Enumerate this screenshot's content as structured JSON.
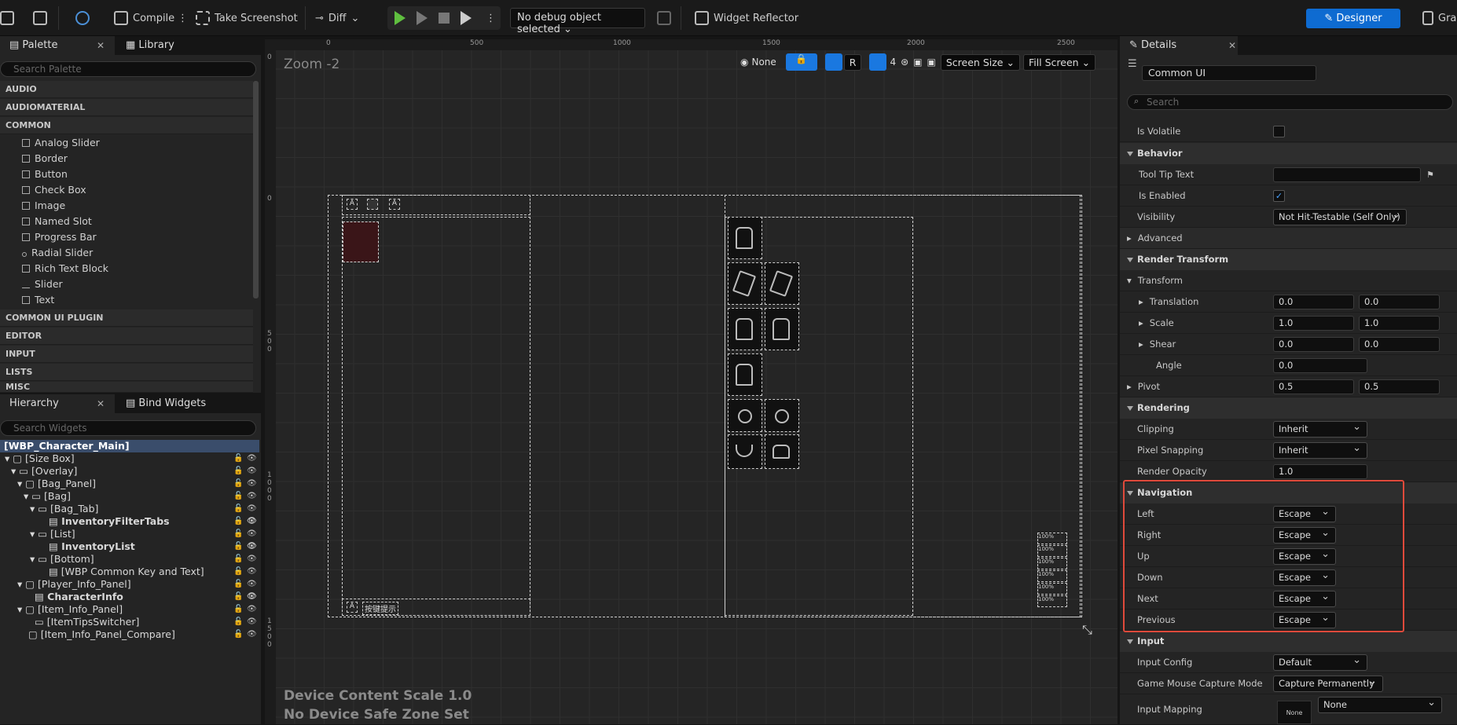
{
  "toolbar": {
    "compile": "Compile",
    "take_screenshot": "Take Screenshot",
    "diff": "Diff",
    "debug_object": "No debug object selected",
    "widget_reflector": "Widget Reflector",
    "designer": "Designer",
    "graph_partial": "Gra"
  },
  "palette": {
    "tab_palette": "Palette",
    "tab_library": "Library",
    "search_placeholder": "Search Palette",
    "categories": [
      "AUDIO",
      "AUDIOMATERIAL",
      "COMMON",
      "COMMON UI PLUGIN",
      "EDITOR",
      "INPUT",
      "LISTS",
      "MISC"
    ],
    "common_items": [
      "Analog Slider",
      "Border",
      "Button",
      "Check Box",
      "Image",
      "Named Slot",
      "Progress Bar",
      "Radial Slider",
      "Rich Text Block",
      "Slider",
      "Text"
    ]
  },
  "hierarchy": {
    "tab_hierarchy": "Hierarchy",
    "tab_bind": "Bind Widgets",
    "search_placeholder": "Search Widgets",
    "root": "[WBP_Character_Main]",
    "rows": [
      "[Size Box]",
      "[Overlay]",
      "[Bag_Panel]",
      "[Bag]",
      "[Bag_Tab]",
      "InventoryFilterTabs",
      "[List]",
      "InventoryList",
      "[Bottom]",
      "[WBP Common Key and Text]",
      "[Player_Info_Panel]",
      "CharacterInfo",
      "[Item_Info_Panel]",
      "[ItemTipsSwitcher]",
      "[Item_Info_Panel_Compare]"
    ]
  },
  "canvas": {
    "zoom": "Zoom -2",
    "ruler_top": [
      "0",
      "500",
      "1000",
      "1500",
      "2000",
      "2500"
    ],
    "ruler_left": [
      "0",
      "500",
      "1000",
      "1500"
    ],
    "none_label": "None",
    "r_label": "R",
    "grid_value": "4",
    "screen_size": "Screen Size",
    "fill_screen": "Fill Screen",
    "device_scale": "Device Content Scale 1.0",
    "safe_zone": "No Device Safe Zone Set",
    "bottom_key_text": "按键提示",
    "percent_label": "100%",
    "a_label": "A"
  },
  "details": {
    "tab": "Details",
    "name_value": "Common UI",
    "search_placeholder": "Search",
    "is_volatile": "Is Volatile",
    "behavior": "Behavior",
    "tool_tip_text": "Tool Tip Text",
    "is_enabled": "Is Enabled",
    "visibility": "Visibility",
    "visibility_value": "Not Hit-Testable (Self Only)",
    "advanced": "Advanced",
    "render_transform": "Render Transform",
    "transform": "Transform",
    "translation": "Translation",
    "translation_x": "0.0",
    "translation_y": "0.0",
    "scale": "Scale",
    "scale_x": "1.0",
    "scale_y": "1.0",
    "shear": "Shear",
    "shear_x": "0.0",
    "shear_y": "0.0",
    "angle": "Angle",
    "angle_value": "0.0",
    "pivot": "Pivot",
    "pivot_x": "0.5",
    "pivot_y": "0.5",
    "rendering": "Rendering",
    "clipping": "Clipping",
    "clipping_value": "Inherit",
    "pixel_snapping": "Pixel Snapping",
    "pixel_snapping_value": "Inherit",
    "render_opacity": "Render Opacity",
    "render_opacity_value": "1.0",
    "navigation": "Navigation",
    "nav_rows": [
      {
        "label": "Left",
        "value": "Escape"
      },
      {
        "label": "Right",
        "value": "Escape"
      },
      {
        "label": "Up",
        "value": "Escape"
      },
      {
        "label": "Down",
        "value": "Escape"
      },
      {
        "label": "Next",
        "value": "Escape"
      },
      {
        "label": "Previous",
        "value": "Escape"
      }
    ],
    "input": "Input",
    "input_config": "Input Config",
    "input_config_value": "Default",
    "game_mouse": "Game Mouse Capture Mode",
    "game_mouse_value": "Capture Permanently",
    "input_mapping": "Input Mapping",
    "input_mapping_value": "None",
    "input_mapping_thumb": "None"
  },
  "colors": {
    "accent": "#0e6bd1",
    "highlight": "#e04a3b"
  }
}
